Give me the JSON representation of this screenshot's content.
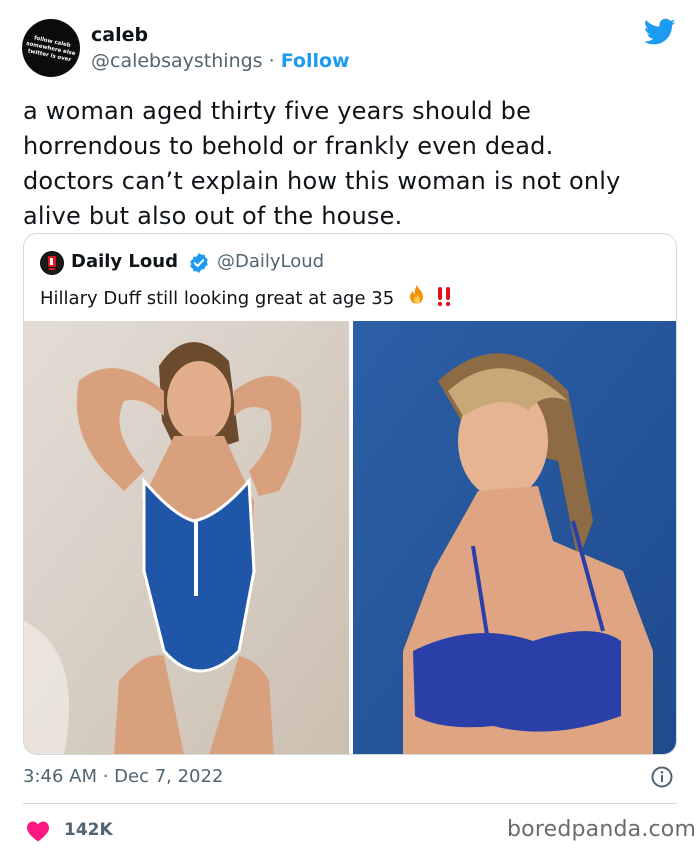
{
  "author": {
    "name": "caleb",
    "handle": "@calebsaysthings",
    "separator": " · ",
    "follow_label": "Follow",
    "avatar_text": [
      "follow caleb",
      "somewhere else",
      "twitter is over"
    ]
  },
  "tweet": {
    "lines": [
      "a woman aged thirty five years should be",
      "horrendous to behold or frankly even dead.",
      "doctors can’t explain how this woman is not only",
      "alive but also out of the house."
    ]
  },
  "quote": {
    "name": "Daily Loud",
    "handle": "@DailyLoud",
    "text": "Hillary Duff still looking great at age 35",
    "emoji_icons": [
      "fire-icon",
      "double-exclamation-icon"
    ]
  },
  "footer": {
    "timestamp": "3:46 AM · Dec 7, 2022",
    "likes": "142K",
    "watermark": "boredpanda.com"
  },
  "colors": {
    "twitter_blue": "#1d9bf0",
    "like_red": "#f91880",
    "muted_text": "#536471",
    "border": "#cfd9de"
  }
}
